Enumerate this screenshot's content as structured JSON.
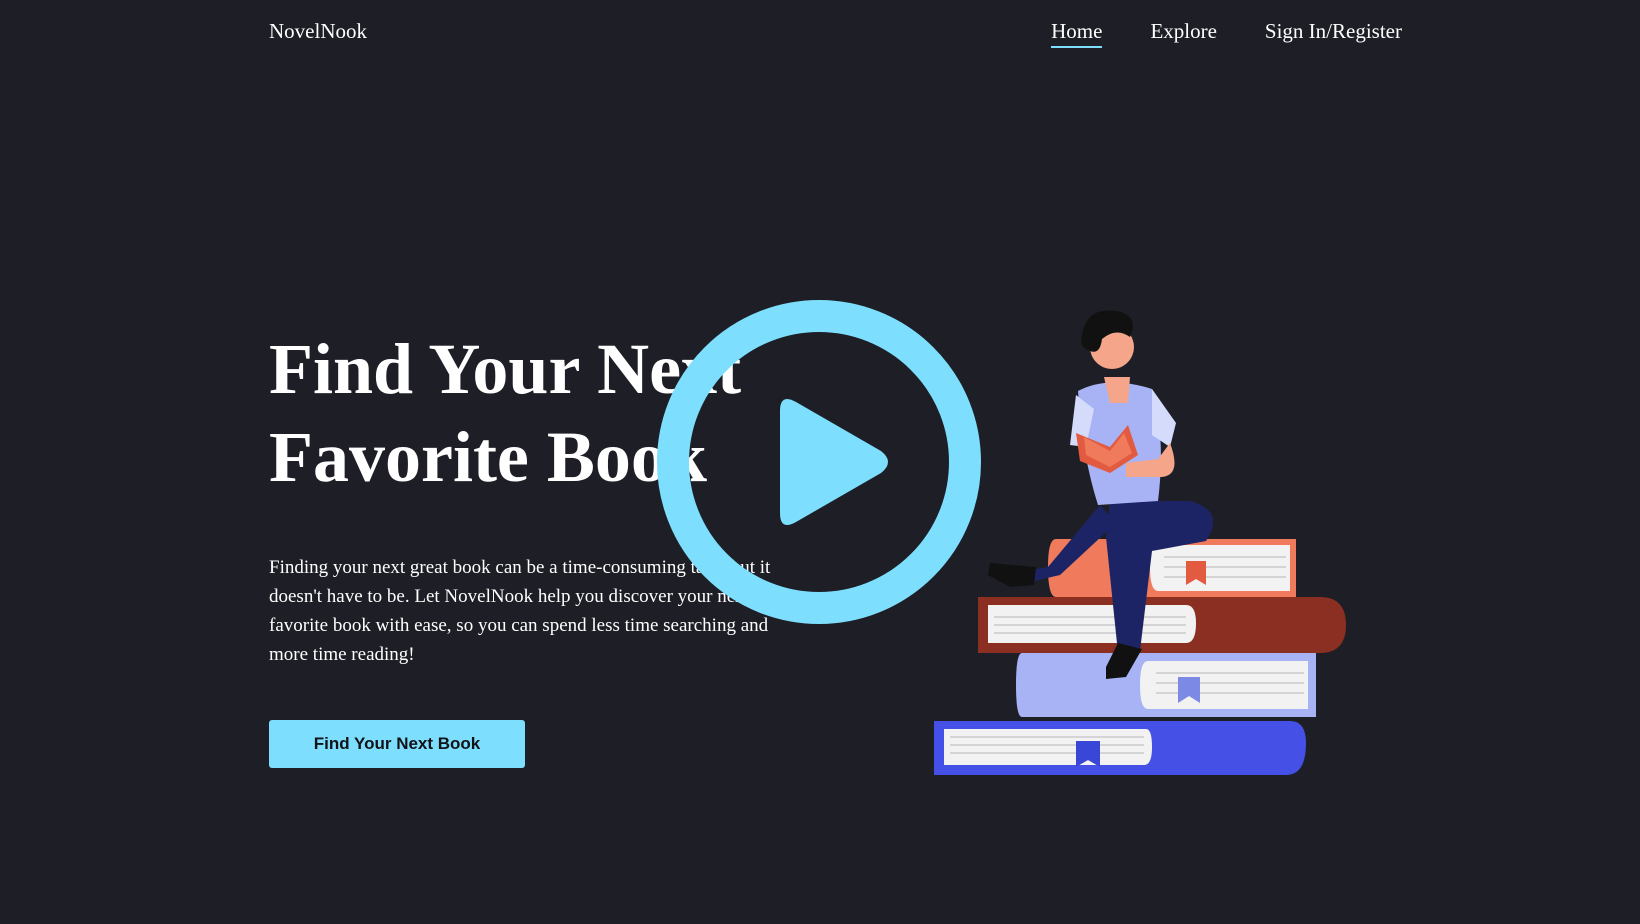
{
  "nav": {
    "brand": "NovelNook",
    "links": [
      {
        "label": "Home",
        "active": true
      },
      {
        "label": "Explore",
        "active": false
      },
      {
        "label": "Sign In/Register",
        "active": false
      }
    ]
  },
  "hero": {
    "title_line1": "Find Your Next",
    "title_line2": "Favorite Book",
    "description": "Finding your next great book can be a time-consuming task, but it doesn't have to be. Let NovelNook help you discover your next favorite book with ease, so you can spend less time searching and more time reading!",
    "cta_label": "Find Your Next Book"
  },
  "illustration": {
    "icon": "person-reading-on-book-stack-illustration"
  },
  "overlay": {
    "icon": "play-icon"
  },
  "colors": {
    "background": "#1e1f26",
    "accent": "#7ddffd",
    "text": "#ffffff",
    "button_text": "#111318"
  }
}
